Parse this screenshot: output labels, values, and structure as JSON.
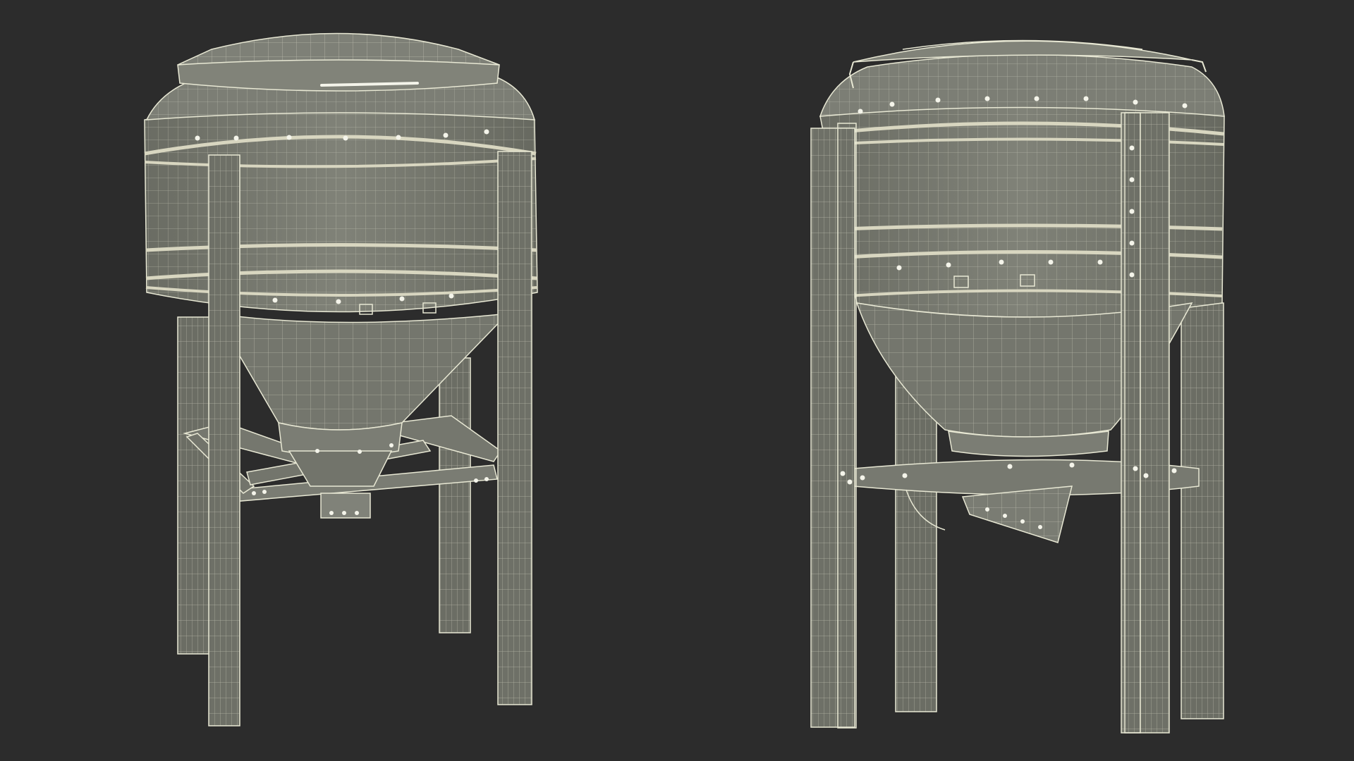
{
  "scene": {
    "background_color": "#2c2c2c",
    "surface_color": "#77796f",
    "surface_dark_color": "#5f6158",
    "wire_color": "#e8e8d4",
    "band_color": "#d8d6c0",
    "bolt_color": "#f4f4ea",
    "models": [
      {
        "name": "hopper-silo-front-three-quarter-view",
        "view": "three-quarter",
        "legs": 4,
        "cross_bracing": true,
        "discharge": "straight"
      },
      {
        "name": "hopper-silo-side-view",
        "view": "side",
        "legs": 4,
        "cross_bracing": true,
        "discharge": "angled"
      }
    ]
  }
}
